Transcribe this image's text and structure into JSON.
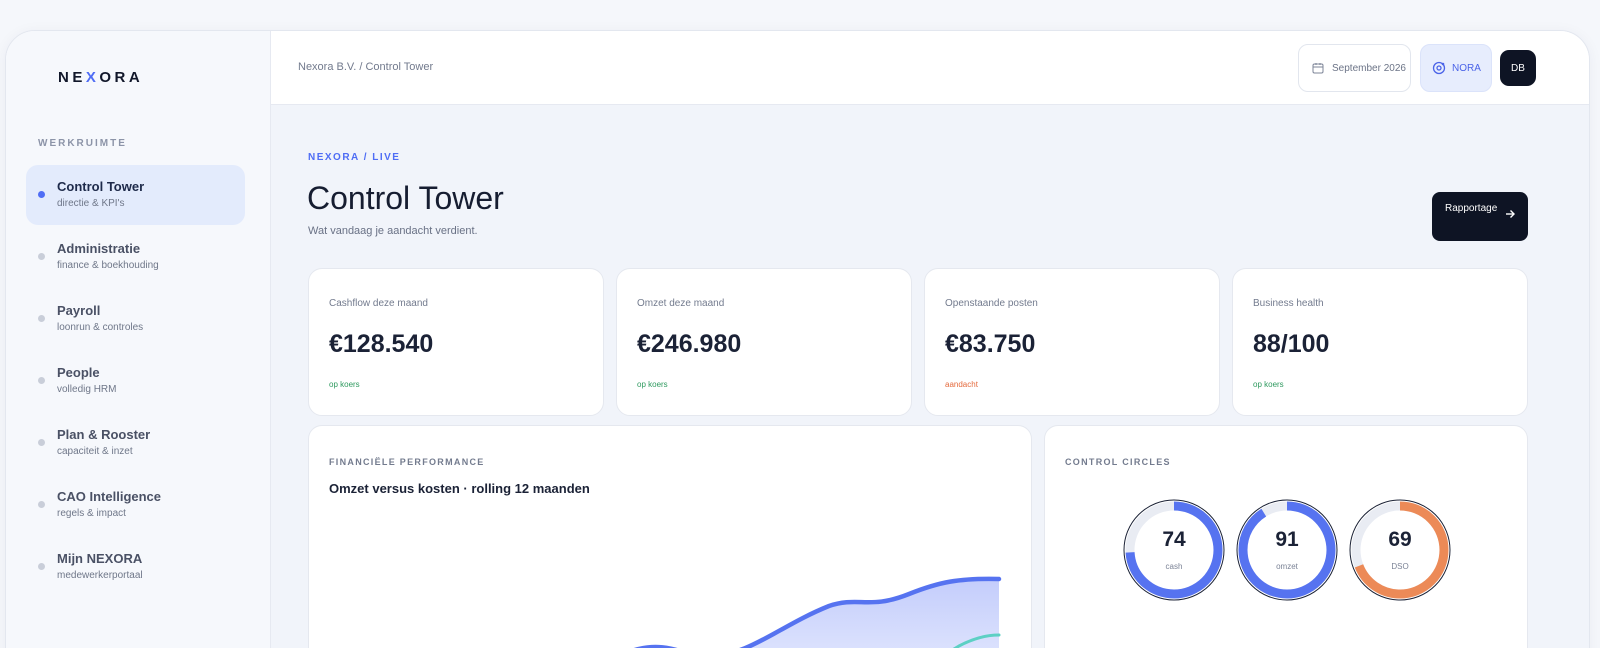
{
  "brand": {
    "logo": "NEXORA"
  },
  "sidebar": {
    "section_label": "WERKRUIMTE",
    "items": [
      {
        "title": "Control Tower",
        "sub": "directie & KPI's",
        "active": true
      },
      {
        "title": "Administratie",
        "sub": "finance & boekhouding",
        "active": false
      },
      {
        "title": "Payroll",
        "sub": "loonrun & controles",
        "active": false
      },
      {
        "title": "People",
        "sub": "volledig HRM",
        "active": false
      },
      {
        "title": "Plan & Rooster",
        "sub": "capaciteit & inzet",
        "active": false
      },
      {
        "title": "CAO Intelligence",
        "sub": "regels & impact",
        "active": false
      },
      {
        "title": "Mijn NEXORA",
        "sub": "medewerkerportaal",
        "active": false
      }
    ]
  },
  "header": {
    "breadcrumb": "Nexora B.V. / Control Tower",
    "date_label": "September 2026",
    "assistant_label": "NORA",
    "avatar_initials": "DB"
  },
  "page": {
    "eyebrow": "NEXORA / LIVE",
    "title": "Control Tower",
    "subtitle": "Wat vandaag je aandacht verdient.",
    "report_button": "Rapportage"
  },
  "kpis": [
    {
      "label": "Cashflow deze maand",
      "value": "€128.540",
      "status": "op koers",
      "status_color": "#2f9a5f"
    },
    {
      "label": "Omzet deze maand",
      "value": "€246.980",
      "status": "op koers",
      "status_color": "#2f9a5f"
    },
    {
      "label": "Openstaande posten",
      "value": "€83.750",
      "status": "aandacht",
      "status_color": "#e46a3d"
    },
    {
      "label": "Business health",
      "value": "88/100",
      "status": "op koers",
      "status_color": "#2f9a5f"
    }
  ],
  "performance": {
    "eyebrow": "FINANCIËLE PERFORMANCE",
    "title": "Omzet versus kosten · rolling 12 maanden"
  },
  "circles": {
    "eyebrow": "CONTROL CIRCLES",
    "items": [
      {
        "value": 74,
        "label": "cash",
        "color": "#5673f0"
      },
      {
        "value": 91,
        "label": "omzet",
        "color": "#5673f0"
      },
      {
        "value": 69,
        "label": "DSO",
        "color": "#ec8a57"
      }
    ]
  },
  "colors": {
    "accent": "#4f6df5",
    "dark": "#0e1424",
    "teal": "#5dd0c4"
  }
}
